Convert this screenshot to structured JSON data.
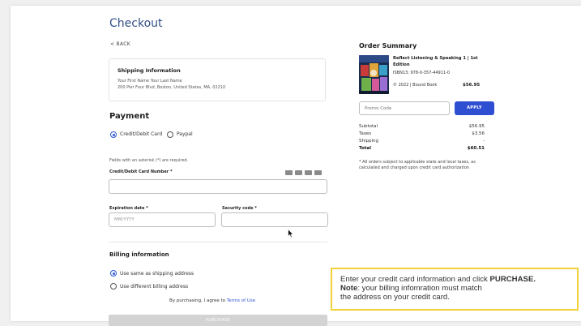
{
  "page": {
    "title": "Checkout",
    "back_label": "< BACK"
  },
  "shipping": {
    "heading": "Shipping Information",
    "name": "Your First Name Your Last Name",
    "address": "200 Pier Four Blvd, Boston, United States, MA, 02210"
  },
  "payment": {
    "heading": "Payment",
    "methods": [
      {
        "label": "Credit/Debit Card",
        "selected": true
      },
      {
        "label": "Paypal",
        "selected": false
      }
    ],
    "required_note": "Fields with an asterisk (*) are required.",
    "card_number_label": "Credit/Debit Card Number *",
    "card_number_value": "",
    "card_icons": [
      "visa-icon",
      "mastercard-icon",
      "amex-icon",
      "discover-icon"
    ],
    "expiration_label": "Expiration date *",
    "expiration_placeholder": "MM/YYYY",
    "security_label": "Security code *",
    "security_value": ""
  },
  "billing": {
    "heading": "Billing information",
    "options": [
      {
        "label": "Use same as shipping address",
        "selected": true
      },
      {
        "label": "Use different billing address",
        "selected": false
      }
    ],
    "agree_prefix": "By purchasing, I agree to",
    "terms_link": "Terms of Use",
    "purchase_label": "PURCHASE"
  },
  "order_summary": {
    "heading": "Order Summary",
    "book": {
      "title": "Reflect Listening & Speaking 1 | 1st Edition",
      "isbn": "ISBN13: 978-0-357-44911-0",
      "meta": "© 2022 | Bound Book",
      "price": "$56.95"
    },
    "promo_placeholder": "Promo Code",
    "apply_label": "APPLY",
    "rows": [
      {
        "label": "Subtotal",
        "value": "$56.95"
      },
      {
        "label": "Taxes",
        "value": "$3.56"
      },
      {
        "label": "Shipping",
        "value": "-"
      },
      {
        "label": "Total",
        "value": "$60.51"
      }
    ],
    "note": "* All orders subject to applicable state and local taxes, as calculated and charged upon credit card authorization"
  },
  "tooltip": {
    "line1_prefix": "Enter your credit card information and click ",
    "line1_bold": "PURCHASE.",
    "line2_bold": "Note",
    "line2_rest": ": your billing infomration must match",
    "line3": "the address on your credit card."
  },
  "colors": {
    "accent": "#2f4fd3",
    "title": "#33508a",
    "tooltip_border": "#f2d13a"
  }
}
